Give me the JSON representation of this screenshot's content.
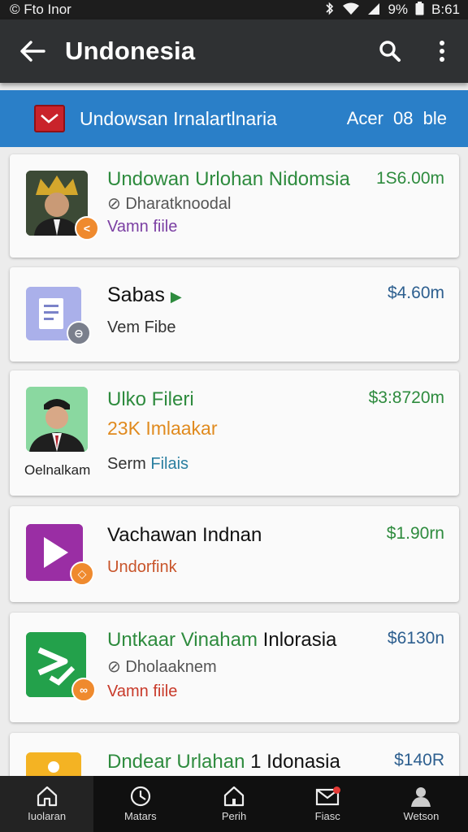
{
  "status_bar": {
    "left_text": "Fto Inor",
    "battery": "9%",
    "time": "B:61"
  },
  "app_bar": {
    "title": "Undonesia",
    "back_icon": "arrow-left-icon",
    "search_icon": "search-icon",
    "more_icon": "more-vert-icon"
  },
  "banner": {
    "title": "Undowsan Irnalartlnaria",
    "meta": "Acer 08 ble",
    "color": "#2a7fc8"
  },
  "items": [
    {
      "title": "Undowan Urlohan Nidomsia",
      "subtitle": "Dharatknoodal",
      "footer": "Vamn fiile",
      "price": "1S6.00m",
      "title_color": "#2e8b3e",
      "footer_color": "#7b3fa3",
      "price_color": "#2e8b3e"
    },
    {
      "title": "Sabas",
      "footer": "Vem Fibe",
      "price": "$4.60m",
      "title_color": "#111111",
      "footer_color": "#333333",
      "price_color": "#2d5f8f"
    },
    {
      "title": "Ulko Fileri",
      "subtitle": "23K Imlaakar",
      "footer_a": "Serm",
      "footer_b": "Filais",
      "caption": "Oelnalkam",
      "price": "$3:8720m",
      "title_color": "#2e8b3e",
      "subtitle_color": "#e08a1e",
      "footer_b_color": "#2a7fa0",
      "price_color": "#2e8b3e"
    },
    {
      "title": "Vachawan Indnan",
      "footer": "Undorfink",
      "price": "$1.90rn",
      "title_color": "#111111",
      "footer_color": "#c8542a",
      "price_color": "#2e8b3e"
    },
    {
      "title_a": "Untkaar Vinaham",
      "title_b": "Inlorasia",
      "subtitle": "Dholaaknem",
      "footer": "Vamn fiile",
      "price": "$6130n",
      "title_color": "#2e8b3e",
      "footer_color": "#c83a2a",
      "price_color": "#2d5f8f"
    },
    {
      "title_a": "Dndear Urlahan",
      "title_b": "1 Idonasia",
      "price": "$140R",
      "title_color": "#2e8b3e",
      "price_color": "#2d5f8f"
    }
  ],
  "bottom_nav": [
    {
      "label": "Iuolaran",
      "icon": "home-icon",
      "active": true
    },
    {
      "label": "Matars",
      "icon": "clock-icon",
      "active": false
    },
    {
      "label": "Perih",
      "icon": "home-outline-icon",
      "active": false
    },
    {
      "label": "Fiasc",
      "icon": "mail-icon",
      "active": false
    },
    {
      "label": "Wetson",
      "icon": "person-icon",
      "active": false
    }
  ]
}
